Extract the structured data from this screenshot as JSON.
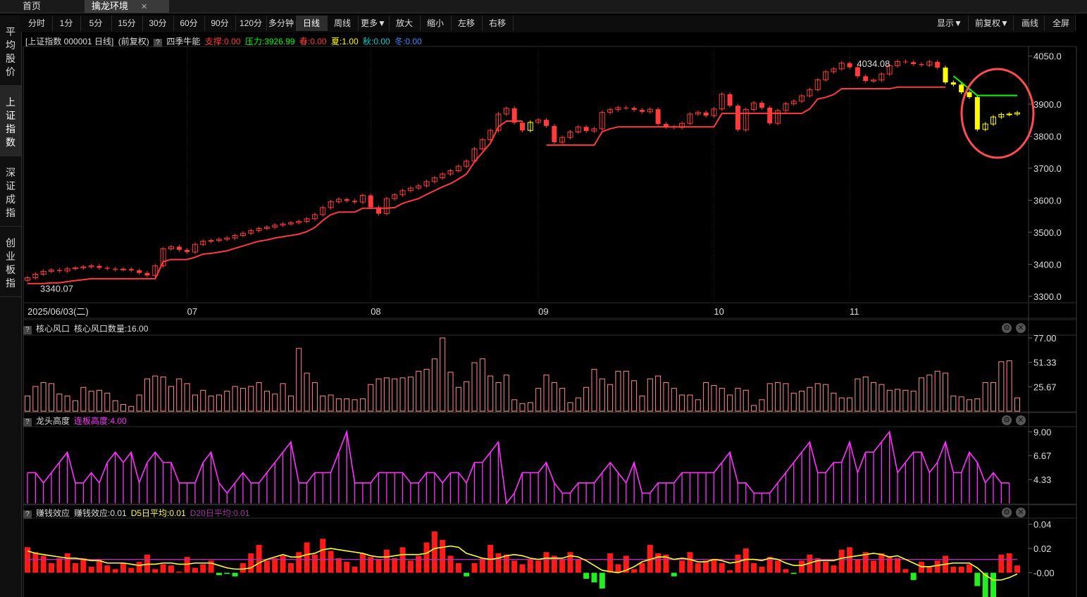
{
  "tabs": [
    {
      "label": "首页"
    },
    {
      "label": "擒龙环境",
      "close": "✕"
    }
  ],
  "toolbar": {
    "periods": [
      "分时",
      "1分",
      "5分",
      "15分",
      "30分",
      "60分",
      "90分",
      "120分",
      "多分钟",
      "日线",
      "周线",
      "更多▼",
      "放大",
      "缩小",
      "左移",
      "右移"
    ],
    "active": "日线",
    "right": [
      "显示▼",
      "前复权▼",
      "画线",
      "全屏"
    ]
  },
  "sidebar": [
    "平均股价",
    "上证指数",
    "深证成指",
    "创业板指"
  ],
  "sidebar_active": "上证指数",
  "info": {
    "title": "[上证指数 000001 日线]",
    "adj": "(前复权)",
    "q": "?",
    "indicator": "四季牛能",
    "support": "支撑:0.00",
    "pressure": "压力:3926.99",
    "spring": "春:0.00",
    "summer": "夏:1.00",
    "autumn": "秋:0.00",
    "winter": "冬:0.00"
  },
  "colors": {
    "up": "#ff3b3b",
    "down": "#00d5d5",
    "yellow": "#ffff00",
    "green": "#00ff00",
    "magenta": "#ff33ff",
    "wind": "#ff8a8a",
    "ma5": "#ffff33",
    "ma20": "#aa33aa",
    "circle": "#ff4d4d"
  },
  "chart_data": [
    {
      "type": "candlestick",
      "title": "上证指数 000001 日线",
      "yticks": [
        "4050.0",
        "3900.0",
        "3800.0",
        "3700.0",
        "3600.0",
        "3500.0",
        "3400.0",
        "3300.0"
      ],
      "ytick_values": [
        4050,
        3900,
        3800,
        3700,
        3600,
        3500,
        3400,
        3300
      ],
      "ylim": [
        3280,
        4080
      ],
      "xlabels": [
        {
          "label": "2025/06/03(二)",
          "i": 0
        },
        {
          "label": "07",
          "i": 20
        },
        {
          "label": "08",
          "i": 43
        },
        {
          "label": "09",
          "i": 64
        },
        {
          "label": "10",
          "i": 86
        },
        {
          "label": "11",
          "i": 103
        }
      ],
      "annotations": [
        {
          "label": "3340.07",
          "i": 0,
          "value": 3340.07
        },
        {
          "label": "4034.08",
          "i": 107,
          "value": 4034.08
        }
      ],
      "closes": [
        3358,
        3369,
        3378,
        3382,
        3379,
        3386,
        3389,
        3392,
        3395,
        3389,
        3386,
        3383,
        3385,
        3381,
        3373,
        3365,
        3395,
        3448,
        3455,
        3445,
        3438,
        3462,
        3472,
        3474,
        3478,
        3482,
        3490,
        3497,
        3505,
        3512,
        3516,
        3522,
        3526,
        3530,
        3534,
        3542,
        3555,
        3577,
        3595,
        3603,
        3598,
        3594,
        3615,
        3578,
        3558,
        3605,
        3617,
        3630,
        3638,
        3645,
        3658,
        3670,
        3682,
        3692,
        3706,
        3722,
        3760,
        3789,
        3818,
        3869,
        3887,
        3842,
        3818,
        3843,
        3851,
        3832,
        3781,
        3796,
        3813,
        3829,
        3816,
        3823,
        3874,
        3883,
        3889,
        3888,
        3882,
        3876,
        3884,
        3838,
        3829,
        3827,
        3840,
        3869,
        3874,
        3864,
        3885,
        3931,
        3895,
        3820,
        3883,
        3904,
        3889,
        3840,
        3880,
        3901,
        3909,
        3926,
        3945,
        3976,
        4001,
        4010,
        4028,
        4015,
        3987,
        3972,
        3975,
        3994,
        4020,
        4033,
        4031,
        4025,
        4022,
        4032,
        4014,
        3968,
        3961,
        3937,
        3922,
        3821,
        3838,
        3860,
        3868,
        3869,
        3873
      ]
    },
    {
      "type": "bar",
      "title": "核心风口",
      "label": "核心风口数量:16.00",
      "yticks": [
        "77.00",
        "51.33",
        "25.67"
      ],
      "ytick_values": [
        77,
        51.33,
        25.67
      ],
      "ylim": [
        0,
        80
      ],
      "values": [
        16,
        26,
        30,
        29,
        18,
        16,
        11,
        25,
        21,
        22,
        19,
        11,
        7,
        5,
        17,
        34,
        37,
        36,
        26,
        34,
        29,
        17,
        22,
        16,
        17,
        21,
        26,
        24,
        26,
        30,
        21,
        18,
        29,
        16,
        66,
        40,
        30,
        16,
        17,
        13,
        13,
        12,
        13,
        28,
        34,
        35,
        34,
        35,
        36,
        42,
        44,
        55,
        77,
        41,
        25,
        31,
        51,
        55,
        37,
        30,
        38,
        12,
        8,
        9,
        24,
        38,
        30,
        24,
        9,
        14,
        25,
        44,
        34,
        28,
        42,
        42,
        32,
        16,
        34,
        37,
        30,
        24,
        17,
        17,
        12,
        30,
        27,
        24,
        17,
        24,
        22,
        6,
        12,
        29,
        30,
        29,
        19,
        21,
        25,
        29,
        28,
        19,
        14,
        14,
        34,
        36,
        30,
        28,
        22,
        23,
        22,
        21,
        35,
        38,
        42,
        40,
        16,
        15,
        12,
        13,
        30,
        30,
        52,
        53,
        14,
        15
      ]
    },
    {
      "type": "line",
      "title": "龙头高度",
      "label": "连板高度:4.00",
      "yticks": [
        "9.00",
        "6.67",
        "4.33"
      ],
      "ytick_values": [
        9,
        6.67,
        4.33
      ],
      "ylim": [
        2,
        9.5
      ],
      "values": [
        5,
        5,
        4,
        5,
        6,
        7,
        4,
        4,
        5,
        4,
        6,
        7,
        6,
        7,
        4,
        6,
        7,
        6,
        6,
        4,
        4,
        4,
        6,
        7,
        4,
        3,
        4,
        5,
        4,
        4,
        5,
        6,
        7,
        8,
        4,
        4,
        5,
        5,
        5,
        7,
        9,
        4,
        4,
        4,
        5,
        5,
        5,
        5,
        4,
        4,
        5,
        5,
        4,
        5,
        5,
        4,
        6,
        6,
        7,
        8,
        2,
        3,
        5,
        5,
        5,
        6,
        4,
        3,
        3,
        4,
        4,
        4,
        5,
        6,
        5,
        4,
        6,
        3,
        3,
        4,
        4,
        4,
        5,
        5,
        5,
        5,
        5,
        6,
        7,
        4,
        4,
        3,
        3,
        3,
        4,
        5,
        6,
        7,
        8,
        5,
        5,
        6,
        6,
        8,
        5,
        7,
        7,
        8,
        9,
        5,
        6,
        7,
        7,
        5,
        6,
        8,
        5,
        5,
        7,
        6,
        4,
        5,
        4,
        4
      ]
    },
    {
      "type": "bar",
      "title": "赚钱效应",
      "label": "赚钱效应:0.01",
      "ma5_label": "D5日平均:0.01",
      "ma20_label": "D20日平均:0.01",
      "yticks": [
        "0.04",
        "0.02",
        "-0.00"
      ],
      "ytick_values": [
        0.04,
        0.02,
        0
      ],
      "ylim": [
        -0.02,
        0.045
      ],
      "values": [
        0.021,
        0.017,
        0.014,
        0.008,
        0.012,
        0.016,
        0.008,
        0.012,
        0.005,
        0.011,
        0.006,
        0.003,
        0.008,
        0.004,
        0.009,
        0.015,
        0.003,
        0.007,
        0.006,
        0.001,
        0.013,
        0.004,
        0.007,
        0.01,
        -0.002,
        -0.001,
        -0.003,
        0.008,
        0.016,
        0.023,
        0.01,
        0.012,
        0.014,
        0.008,
        0.017,
        0.025,
        0.015,
        0.028,
        0.018,
        0.012,
        0.009,
        0.005,
        0.016,
        0.013,
        0.011,
        0.019,
        0.012,
        0.021,
        0.01,
        0.014,
        0.025,
        0.034,
        0.027,
        0.014,
        0.008,
        -0.003,
        0.008,
        0.012,
        0.023,
        0.016,
        0.015,
        0.01,
        0.007,
        0.011,
        0.01,
        0.017,
        0.014,
        0.011,
        0.017,
        0.011,
        -0.005,
        -0.008,
        -0.013,
        0.016,
        0.007,
        0.014,
        0.003,
        0.008,
        0.023,
        0.016,
        0.015,
        -0.003,
        0.01,
        0.017,
        0.008,
        0.01,
        0.011,
        0.008,
        0.002,
        0.015,
        0.02,
        0.008,
        0.005,
        0.013,
        0.01,
        0.003,
        -0.001,
        0.01,
        0.015,
        0.012,
        0.009,
        0.006,
        0.019,
        0.021,
        0.011,
        0.017,
        0.01,
        0.016,
        0.013,
        0.012,
        0.003,
        -0.006,
        0.009,
        0.005,
        0.01,
        0.014,
        0.005,
        0.005,
        0.007,
        -0.011,
        -0.021,
        -0.022,
        0.015,
        0.016,
        0.006,
        0.003,
        0.007,
        0.011
      ],
      "ma5": [
        0.018,
        0.016,
        0.015,
        0.014,
        0.013,
        0.012,
        0.012,
        0.011,
        0.01,
        0.01,
        0.008,
        0.008,
        0.008,
        0.007,
        0.006,
        0.007,
        0.007,
        0.008,
        0.008,
        0.007,
        0.007,
        0.008,
        0.008,
        0.008,
        0.006,
        0.004,
        0.003,
        0.003,
        0.004,
        0.008,
        0.011,
        0.013,
        0.015,
        0.013,
        0.013,
        0.015,
        0.016,
        0.019,
        0.02,
        0.019,
        0.018,
        0.017,
        0.016,
        0.014,
        0.013,
        0.013,
        0.014,
        0.015,
        0.015,
        0.015,
        0.016,
        0.02,
        0.021,
        0.022,
        0.021,
        0.016,
        0.014,
        0.012,
        0.011,
        0.012,
        0.014,
        0.015,
        0.014,
        0.012,
        0.011,
        0.012,
        0.012,
        0.012,
        0.014,
        0.013,
        0.01,
        0.006,
        0.002,
        0.001,
        0.0,
        0.002,
        0.005,
        0.009,
        0.011,
        0.013,
        0.013,
        0.011,
        0.012,
        0.011,
        0.009,
        0.009,
        0.011,
        0.01,
        0.008,
        0.009,
        0.011,
        0.011,
        0.01,
        0.012,
        0.011,
        0.008,
        0.006,
        0.006,
        0.008,
        0.01,
        0.01,
        0.01,
        0.012,
        0.013,
        0.014,
        0.015,
        0.016,
        0.015,
        0.013,
        0.014,
        0.011,
        0.008,
        0.005,
        0.005,
        0.006,
        0.007,
        0.008,
        0.008,
        0.008,
        0.004,
        -0.002,
        -0.006,
        -0.006,
        -0.004,
        -0.001,
        0.003,
        0.009,
        0.008
      ],
      "ma20_level": 0.011
    }
  ]
}
